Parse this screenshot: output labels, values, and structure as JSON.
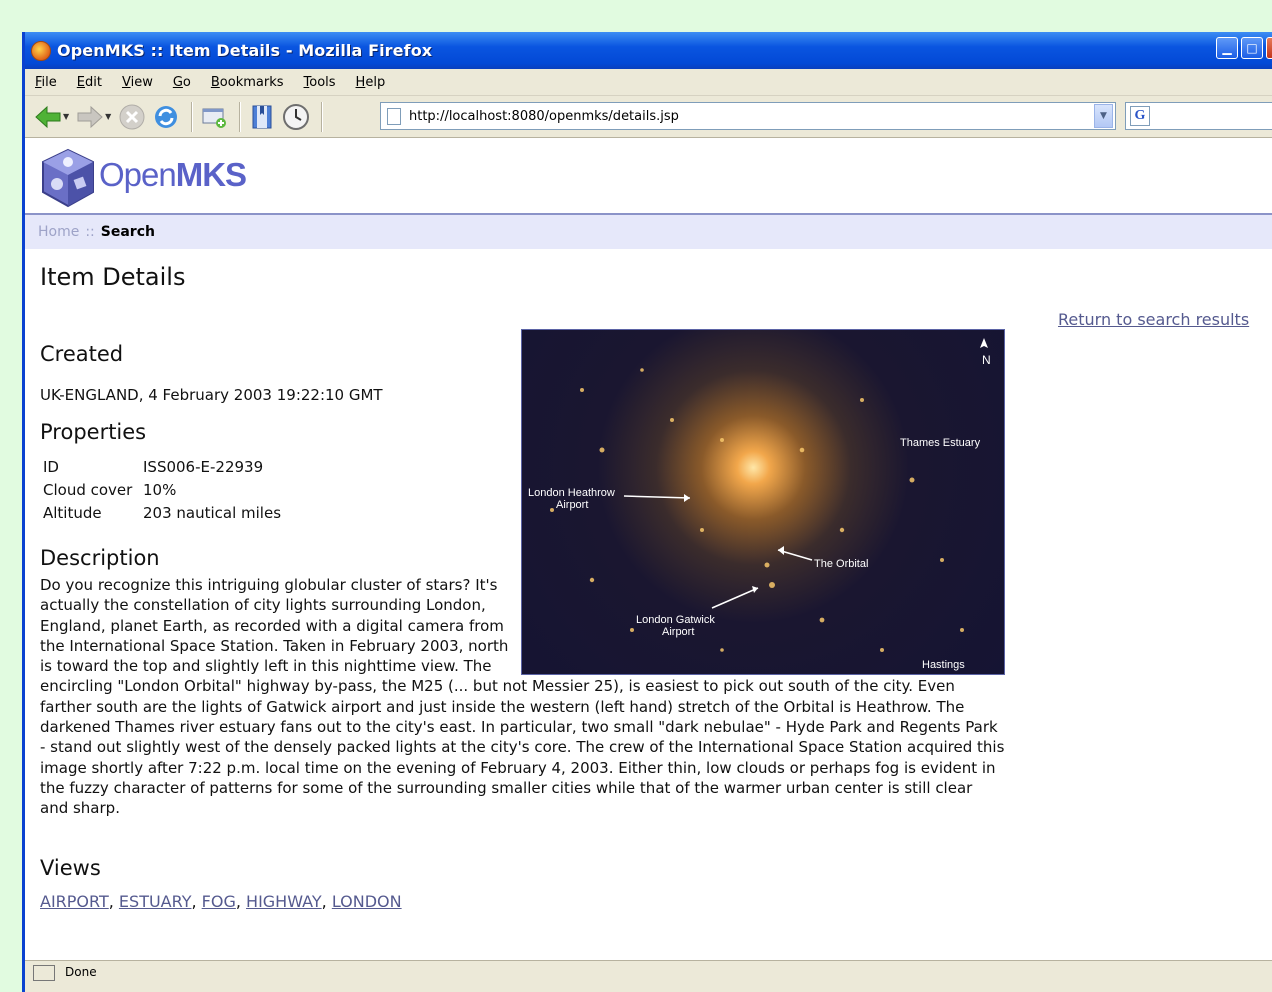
{
  "window": {
    "title": "OpenMKS :: Item Details - Mozilla Firefox"
  },
  "menu": [
    {
      "key": "F",
      "rest": "ile"
    },
    {
      "key": "E",
      "rest": "dit"
    },
    {
      "key": "V",
      "rest": "iew"
    },
    {
      "key": "G",
      "rest": "o"
    },
    {
      "key": "B",
      "rest": "ookmarks"
    },
    {
      "key": "T",
      "rest": "ools"
    },
    {
      "key": "H",
      "rest": "elp"
    }
  ],
  "address": {
    "url": "http://localhost:8080/openmks/details.jsp"
  },
  "logo": {
    "open": "Open",
    "mks": "MKS"
  },
  "breadcrumb": {
    "home": "Home",
    "sep": "::",
    "current": "Search"
  },
  "page": {
    "title": "Item Details",
    "return_link": "Return to search results",
    "created_heading": "Created",
    "created_value": "UK-ENGLAND, 4 February 2003 19:22:10 GMT",
    "properties_heading": "Properties",
    "properties": [
      {
        "key": "ID",
        "value": "ISS006-E-22939"
      },
      {
        "key": "Cloud cover",
        "value": "10%"
      },
      {
        "key": "Altitude",
        "value": "203 nautical miles"
      }
    ],
    "description_heading": "Description",
    "description": "Do you recognize this intriguing globular cluster of stars? It's actually the constellation of city lights surrounding London, England, planet Earth, as recorded with a digital camera from the International Space Station. Taken in February 2003, north is toward the top and slightly left in this nighttime view. The encircling \"London Orbital\" highway by-pass, the M25 (... but not Messier 25), is easiest to pick out south of the city. Even farther south are the lights of Gatwick airport and just inside the western (left hand) stretch of the Orbital is Heathrow. The darkened Thames river estuary fans out to the city's east. In particular, two small \"dark nebulae\" - Hyde Park and Regents Park - stand out slightly west of the densely packed lights at the city's core. The crew of the International Space Station acquired this image shortly after 7:22 p.m. local time on the evening of February 4, 2003. Either thin, low clouds or perhaps fog is evident in the fuzzy character of patterns for some of the surrounding smaller cities while that of the warmer urban center is still clear and sharp.",
    "views_heading": "Views",
    "views": [
      "AIRPORT",
      "ESTUARY",
      "FOG",
      "HIGHWAY",
      "LONDON"
    ]
  },
  "photo_labels": {
    "north": "N",
    "estuary": "Thames Estuary",
    "heathrow_1": "London Heathrow",
    "heathrow_2": "Airport",
    "orbital": "The Orbital",
    "gatwick_1": "London Gatwick",
    "gatwick_2": "Airport",
    "hastings": "Hastings"
  },
  "status": {
    "text": "Done"
  }
}
